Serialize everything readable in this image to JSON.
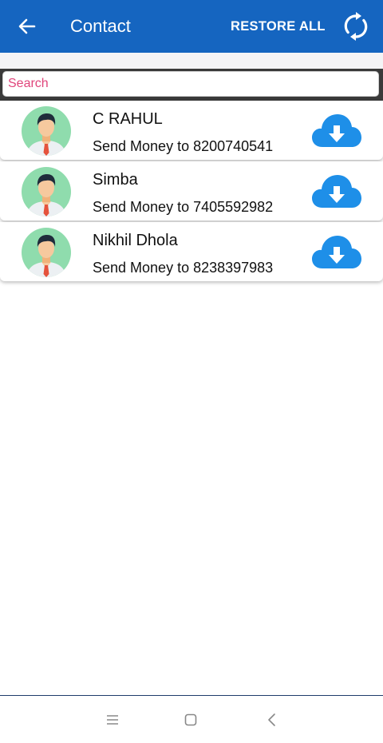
{
  "appbar": {
    "title": "Contact",
    "restore_label": "RESTORE ALL",
    "back_icon": "arrow-back-icon",
    "sync_icon": "sync-icon",
    "color": "#1565c0"
  },
  "search": {
    "placeholder": "Search",
    "value": ""
  },
  "contacts": [
    {
      "name": "C RAHUL",
      "subtitle": "Send Money to 8200740541"
    },
    {
      "name": "Simba",
      "subtitle": "Send Money to 7405592982"
    },
    {
      "name": "Nikhil Dhola",
      "subtitle": "Send Money to 8238397983"
    }
  ],
  "icons": {
    "avatar": "avatar-icon",
    "download": "cloud-download-icon"
  },
  "navbar": {
    "items": [
      "menu-icon",
      "home-icon",
      "back-icon"
    ]
  }
}
